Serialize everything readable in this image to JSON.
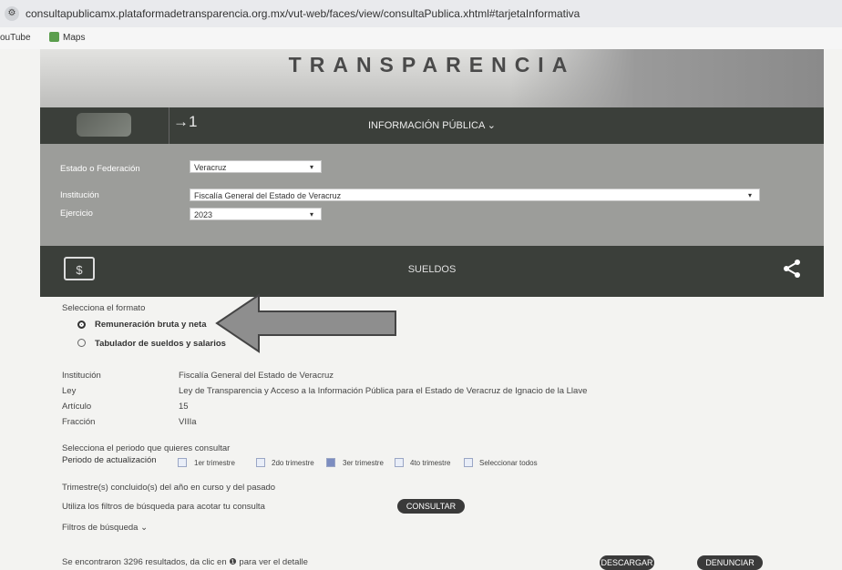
{
  "browser": {
    "url": "consultapublicamx.plataformadetransparencia.org.mx/vut-web/faces/view/consultaPublica.xhtml#tarjetaInformativa",
    "bookmarks": [
      "ouTube",
      "Maps"
    ]
  },
  "header": {
    "title": "TRANSPARENCIA"
  },
  "nav": {
    "icon_text": "→1",
    "menu_label": "INFORMACIÓN PÚBLICA ⌄"
  },
  "filters": {
    "estado_label": "Estado o Federación",
    "estado_value": "Veracruz",
    "institucion_label": "Institución",
    "institucion_value": "Fiscalía General del Estado de Veracruz",
    "ejercicio_label": "Ejercicio",
    "ejercicio_value": "2023"
  },
  "section": {
    "title": "SUELDOS"
  },
  "formato": {
    "label": "Selecciona el formato",
    "options": [
      {
        "label": "Remuneración bruta y neta",
        "selected": true
      },
      {
        "label": "Tabulador de sueldos y salarios",
        "selected": false
      }
    ]
  },
  "info": {
    "institucion_label": "Institución",
    "institucion_value": "Fiscalía General del Estado de Veracruz",
    "ley_label": "Ley",
    "ley_value": "Ley de Transparencia y Acceso a la Información Pública para el Estado de Veracruz de Ignacio de la Llave",
    "articulo_label": "Artículo",
    "articulo_value": "15",
    "fraccion_label": "Fracción",
    "fraccion_value": "VIIIa"
  },
  "periodo": {
    "prompt": "Selecciona el periodo que quieres consultar",
    "label": "Periodo de actualización",
    "options": [
      {
        "label": "1er trimestre",
        "checked": false
      },
      {
        "label": "2do trimestre",
        "checked": false
      },
      {
        "label": "3er trimestre",
        "checked": true
      },
      {
        "label": "4to trimestre",
        "checked": false
      },
      {
        "label": "Seleccionar todos",
        "checked": false
      }
    ],
    "note": "Trimestre(s) concluido(s) del año en curso y del pasado"
  },
  "search": {
    "hint": "Utiliza los filtros de búsqueda para acotar tu consulta",
    "consultar_label": "CONSULTAR",
    "filters_label": "Filtros de búsqueda ⌄"
  },
  "results": {
    "text": "Se encontraron 3296 resultados, da clic en ❶ para ver el detalle",
    "descargar_label": "DESCARGAR",
    "denunciar_label": "DENUNCIAR"
  }
}
